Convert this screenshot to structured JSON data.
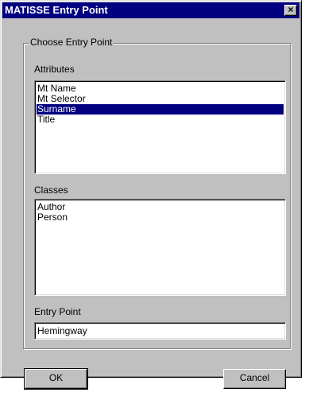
{
  "window": {
    "title": "MATISSE Entry Point",
    "close_label": "✕"
  },
  "group": {
    "title": "Choose Entry Point"
  },
  "attributes": {
    "label": "Attributes",
    "items": [
      "Mt Name",
      "Mt Selector",
      "Surname",
      "Title"
    ],
    "selected": "Surname"
  },
  "classes": {
    "label": "Classes",
    "items": [
      "Author",
      "Person"
    ]
  },
  "entry_point": {
    "label": "Entry Point",
    "value": "Hemingway"
  },
  "buttons": {
    "ok": "OK",
    "cancel": "Cancel"
  },
  "colors": {
    "titlebar": "#000080",
    "selection": "#000080",
    "face": "#c0c0c0"
  }
}
